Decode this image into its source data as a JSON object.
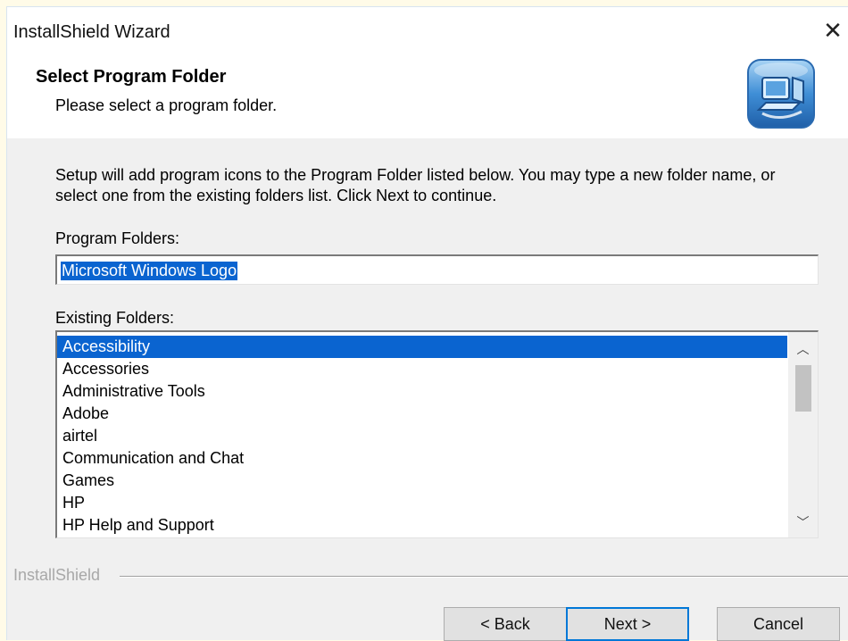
{
  "window": {
    "title": "InstallShield Wizard",
    "close_icon": "close-icon"
  },
  "header": {
    "title": "Select Program Folder",
    "subtitle": "Please select a program folder.",
    "logo_icon": "installer-computer-icon"
  },
  "body": {
    "description": "Setup will add program icons to the Program Folder listed below.  You may type a new folder name, or select one from the existing folders list.  Click Next to continue.",
    "program_folders_label": "Program Folders:",
    "program_folder_value": "Microsoft Windows Logo",
    "existing_folders_label": "Existing Folders:",
    "existing_folders": [
      "Accessibility",
      "Accessories",
      "Administrative Tools",
      "Adobe",
      "airtel",
      "Communication and Chat",
      "Games",
      "HP",
      "HP Help and Support"
    ],
    "selected_folder": "Accessibility"
  },
  "footer": {
    "brand": "InstallShield",
    "back_label": "< Back",
    "next_label": "Next >",
    "cancel_label": "Cancel"
  },
  "colors": {
    "selection": "#0a64d0",
    "default_button_border": "#0078d7"
  }
}
